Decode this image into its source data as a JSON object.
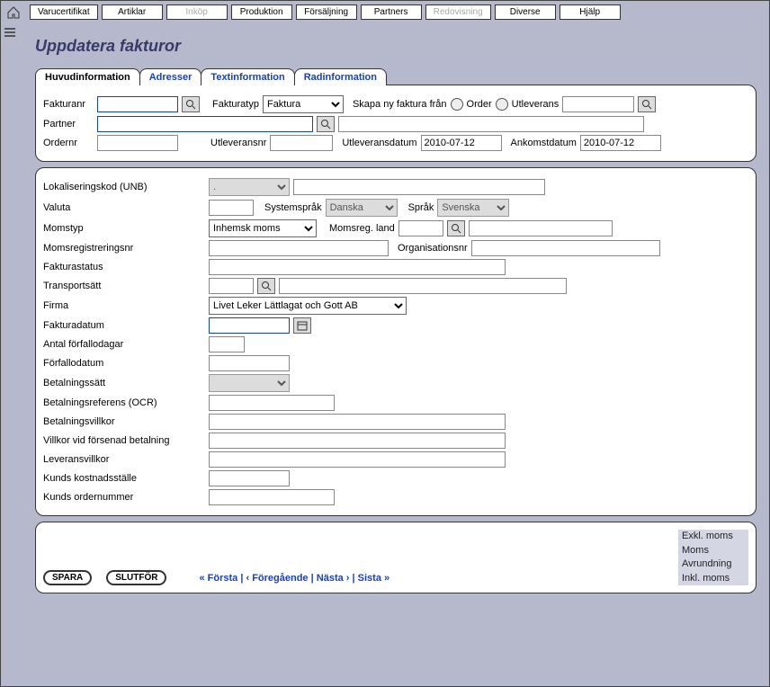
{
  "menus": [
    "Varucertifikat",
    "Artiklar",
    "Inköp",
    "Produktion",
    "Försäljning",
    "Partners",
    "Redovisning",
    "Diverse",
    "Hjälp"
  ],
  "menus_disabled": [
    2,
    6
  ],
  "title": "Uppdatera fakturor",
  "tabs": [
    "Huvudinformation",
    "Adresser",
    "Textinformation",
    "Radinformation"
  ],
  "active_tab": 0,
  "head": {
    "fakturanr_lbl": "Fakturanr",
    "fakturanr": "",
    "fakturatyp_lbl": "Fakturatyp",
    "fakturatyp": "Faktura",
    "skapa_lbl": "Skapa ny faktura från",
    "order_lbl": "Order",
    "utlev_lbl": "Utleverans",
    "utlev_val": "",
    "partner_lbl": "Partner",
    "partner_code": "",
    "partner_name": "",
    "ordernr_lbl": "Ordernr",
    "ordernr": "",
    "utleveransnr_lbl": "Utleveransnr",
    "utleveransnr": "",
    "utleveransdatum_lbl": "Utleveransdatum",
    "utleveransdatum": "2010-07-12",
    "ankomstdatum_lbl": "Ankomstdatum",
    "ankomstdatum": "2010-07-12"
  },
  "body": {
    "lokaliseringskod_lbl": "Lokaliseringskod (UNB)",
    "lokaliseringskod": ".",
    "lok_name": "",
    "valuta_lbl": "Valuta",
    "valuta": "",
    "systemsprak_lbl": "Systemspråk",
    "systemsprak": "Danska",
    "sprak_lbl": "Språk",
    "sprak": "Svenska",
    "momstyp_lbl": "Momstyp",
    "momstyp": "Inhemsk moms",
    "momsregland_lbl": "Momsreg. land",
    "momsregland": "",
    "momsregland_name": "",
    "momsregnr_lbl": "Momsregistreringsnr",
    "momsregnr": "",
    "orgnr_lbl": "Organisationsnr",
    "orgnr": "",
    "fakturastatus_lbl": "Fakturastatus",
    "fakturastatus": "",
    "transportsatt_lbl": "Transportsätt",
    "transportsatt_code": "",
    "transportsatt_name": "",
    "firma_lbl": "Firma",
    "firma": "Livet Leker Lättlagat och Gott AB",
    "fakturadatum_lbl": "Fakturadatum",
    "fakturadatum": "",
    "antal_forfallodagar_lbl": "Antal förfallodagar",
    "antal_forfallodagar": "",
    "forfallodatum_lbl": "Förfallodatum",
    "forfallodatum": "",
    "betalningssatt_lbl": "Betalningssätt",
    "betalningssatt": "",
    "betalningsref_lbl": "Betalningsreferens (OCR)",
    "betalningsref": "",
    "betalningsvillkor_lbl": "Betalningsvillkor",
    "betalningsvillkor": "",
    "villkor_lbl": "Villkor vid försenad betalning",
    "villkor": "",
    "leveransvillkor_lbl": "Leveransvillkor",
    "leveransvillkor": "",
    "kunds_kostnad_lbl": "Kunds kostnadsställe",
    "kunds_kostnad": "",
    "kunds_ordernr_lbl": "Kunds ordernummer",
    "kunds_ordernr": ""
  },
  "footer": {
    "spara": "SPARA",
    "slutfor": "SLUTFÖR",
    "nav_first": "« Första",
    "nav_prev": "‹ Föregående",
    "nav_next": "Nästa ›",
    "nav_last": "Sista »",
    "sep": " | ",
    "totals": [
      "Exkl. moms",
      "Moms",
      "Avrundning",
      "Inkl. moms"
    ]
  }
}
